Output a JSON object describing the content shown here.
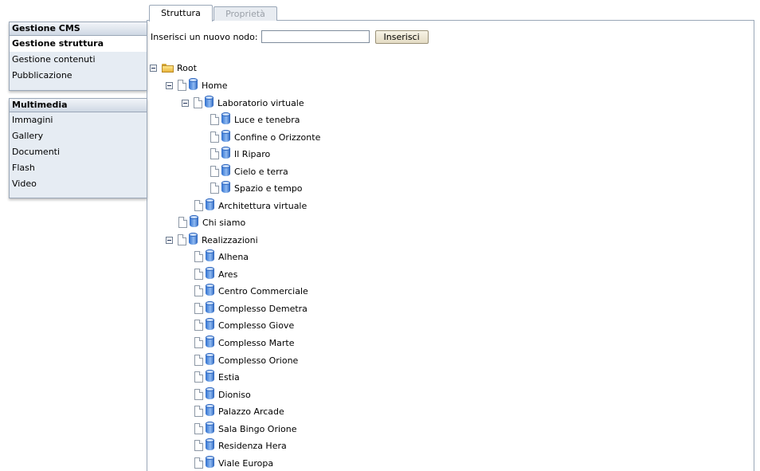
{
  "sidebar": {
    "cms": {
      "header": "Gestione CMS",
      "items": [
        {
          "label": "Gestione struttura",
          "active": true
        },
        {
          "label": "Gestione contenuti"
        },
        {
          "label": "Pubblicazione"
        }
      ]
    },
    "multimedia": {
      "header": "Multimedia",
      "items": [
        {
          "label": "Immagini"
        },
        {
          "label": "Gallery"
        },
        {
          "label": "Documenti"
        },
        {
          "label": "Flash"
        },
        {
          "label": "Video"
        }
      ]
    }
  },
  "tabs": [
    {
      "label": "Struttura",
      "active": true
    },
    {
      "label": "Proprietà",
      "active": false
    }
  ],
  "insert": {
    "label": "Inserisci un nuovo nodo:",
    "value": "",
    "button": "Inserisci"
  },
  "tree": {
    "root": "Root",
    "home": "Home",
    "laboratorio": "Laboratorio virtuale",
    "laboratorio_children": [
      "Luce e tenebra",
      "Confine o Orizzonte",
      "Il Riparo",
      "Cielo e terra",
      "Spazio e tempo"
    ],
    "architettura": "Architettura virtuale",
    "chi_siamo": "Chi siamo",
    "realizzazioni": "Realizzazioni",
    "realizzazioni_children": [
      "Alhena",
      "Ares",
      "Centro Commerciale",
      "Complesso Demetra",
      "Complesso Giove",
      "Complesso Marte",
      "Complesso Orione",
      "Estia",
      "Dioniso",
      "Palazzo Arcade",
      "Sala Bingo Orione",
      "Residenza Hera",
      "Viale Europa"
    ]
  },
  "colors": {
    "panel_bg": "#e6ecf3",
    "border": "#9aa7b8",
    "icon_blue": "#2f6fce",
    "folder": "#e9b53f"
  }
}
